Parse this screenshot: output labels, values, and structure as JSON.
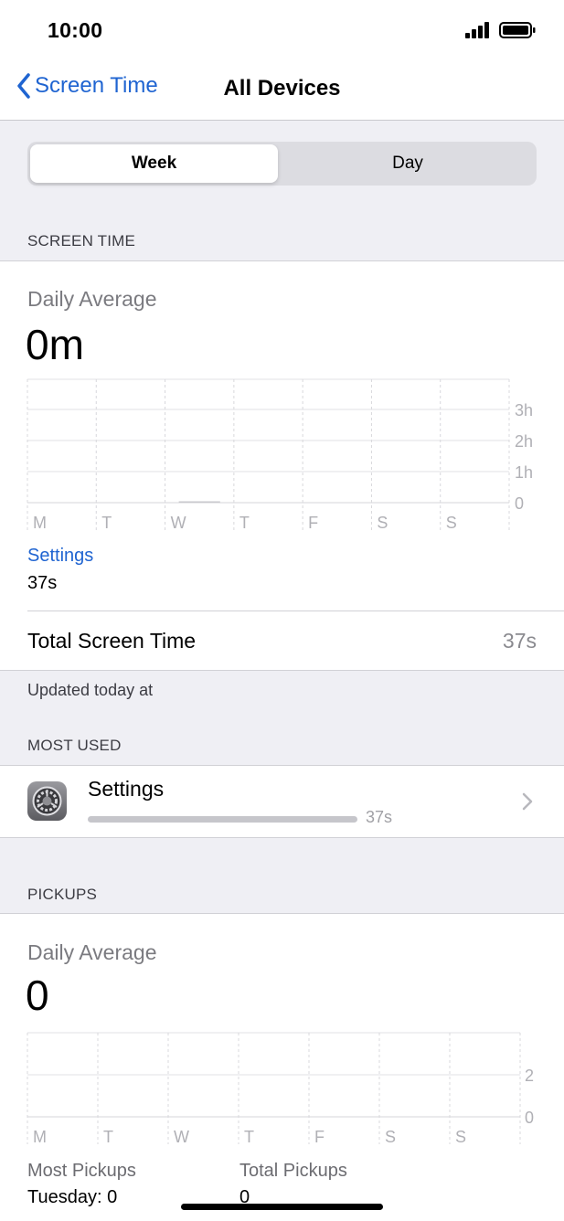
{
  "status_bar": {
    "time": "10:00"
  },
  "nav": {
    "back_label": "Screen Time",
    "title": "All Devices"
  },
  "segment": {
    "week": "Week",
    "day": "Day",
    "selected": "Week"
  },
  "screen_time": {
    "section_header": "SCREEN TIME",
    "daily_average_label": "Daily Average",
    "daily_average_value": "0m",
    "top_app_label": "Settings",
    "top_app_time": "37s",
    "total_label": "Total Screen Time",
    "total_value": "37s",
    "updated_text": "Updated today at"
  },
  "most_used": {
    "section_header": "MOST USED",
    "apps": [
      {
        "name": "Settings",
        "time": "37s",
        "icon": "settings-gear-icon",
        "usage_fraction": 1.0
      }
    ]
  },
  "pickups": {
    "section_header": "PICKUPS",
    "daily_average_label": "Daily Average",
    "daily_average_value": "0",
    "most_pickups_label": "Most Pickups",
    "most_pickups_value": "Tuesday: 0",
    "total_pickups_label": "Total Pickups",
    "total_pickups_value": "0"
  },
  "chart_data": [
    {
      "type": "bar",
      "categories": [
        "M",
        "T",
        "W",
        "T",
        "F",
        "S",
        "S"
      ],
      "y_tick_labels": [
        "3h",
        "2h",
        "1h",
        "0"
      ],
      "values_seconds": [
        0,
        0,
        37,
        0,
        0,
        0,
        0
      ],
      "ylim_hours": [
        0,
        3
      ],
      "grid": true
    },
    {
      "type": "bar",
      "categories": [
        "M",
        "T",
        "W",
        "T",
        "F",
        "S",
        "S"
      ],
      "y_tick_labels": [
        "2",
        "0"
      ],
      "values": [
        0,
        0,
        0,
        0,
        0,
        0,
        0
      ],
      "grid": true
    }
  ],
  "colors": {
    "accent": "#1f64d1",
    "grouped_background": "#efeff4",
    "bar": "#c6c6cb"
  }
}
